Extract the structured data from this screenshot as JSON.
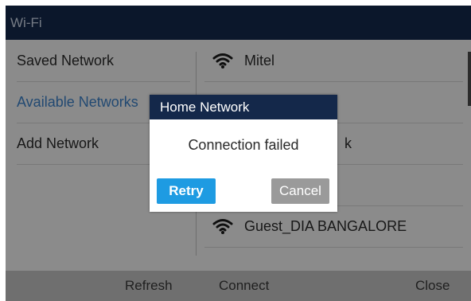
{
  "window": {
    "title": "Wi-Fi"
  },
  "sidebar": {
    "items": [
      {
        "label": "Saved Network",
        "active": false
      },
      {
        "label": "Available Networks",
        "active": true
      },
      {
        "label": "Add Network",
        "active": false
      }
    ]
  },
  "networks": [
    {
      "ssid": "Mitel",
      "icon": "wifi-icon"
    },
    {
      "ssid": "",
      "icon": ""
    },
    {
      "ssid": "k",
      "icon": ""
    },
    {
      "ssid": "",
      "icon": ""
    },
    {
      "ssid": "Guest_DIA BANGALORE",
      "icon": "wifi-icon"
    }
  ],
  "dialog": {
    "title": "Home Network",
    "message": "Connection failed",
    "retry_label": "Retry",
    "cancel_label": "Cancel"
  },
  "softkeys": {
    "refresh": "Refresh",
    "connect": "Connect",
    "close": "Close"
  },
  "colors": {
    "titlebar": "#14284a",
    "active_item": "#3b7fc4",
    "retry_button": "#1e9be2",
    "cancel_button": "#9a9a9a",
    "softkey_bar": "#6f6f6f"
  }
}
